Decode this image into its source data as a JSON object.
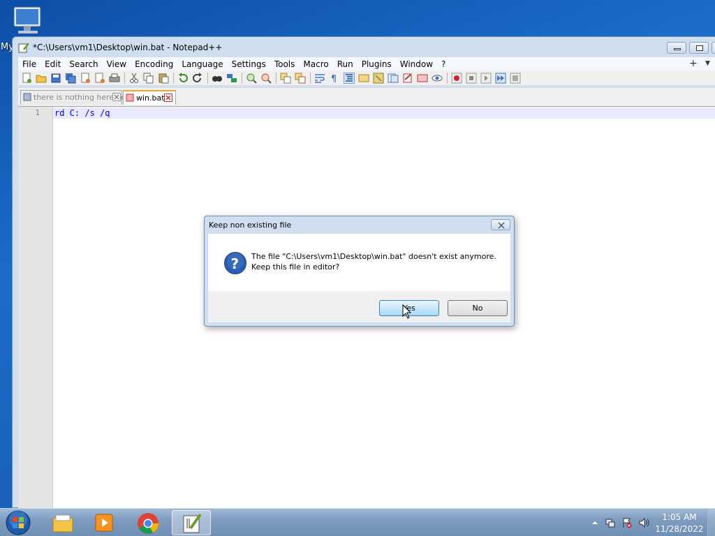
{
  "desktop": {
    "icon_label": "My"
  },
  "window": {
    "title": "*C:\\Users\\vm1\\Desktop\\win.bat - Notepad++"
  },
  "menu": {
    "items": [
      "File",
      "Edit",
      "Search",
      "View",
      "Encoding",
      "Language",
      "Settings",
      "Tools",
      "Macro",
      "Run",
      "Plugins",
      "Window",
      "?"
    ],
    "plus": "+",
    "dropdown": "▼"
  },
  "toolbar": {
    "icons": [
      "new-file-icon",
      "open-file-icon",
      "save-icon",
      "save-all-icon",
      "close-icon",
      "close-all-icon",
      "print-icon",
      "cut-icon",
      "copy-icon",
      "paste-icon",
      "undo-icon",
      "redo-icon",
      "find-icon",
      "replace-icon",
      "zoom-in-icon",
      "zoom-out-icon",
      "sync-vertical-icon",
      "sync-horizontal-icon",
      "word-wrap-icon",
      "show-all-chars-icon",
      "indent-guide-icon",
      "fold-icon",
      "doc-map-icon",
      "function-list-icon",
      "folder-workspace-icon",
      "monitoring-icon",
      "macro-record-icon",
      "macro-stop-icon",
      "macro-play-icon",
      "macro-run-multiple-icon",
      "macro-save-icon"
    ]
  },
  "tabs": [
    {
      "label": "there is nothing here.txt",
      "active": false
    },
    {
      "label": "win.bat",
      "active": true
    }
  ],
  "editor": {
    "line_number": "1",
    "code": "rd C: /s /q"
  },
  "dialog": {
    "title": "Keep non existing file",
    "message_line1": "The file \"C:\\Users\\vm1\\Desktop\\win.bat\" doesn't exist anymore.",
    "message_line2": "Keep this file in editor?",
    "yes_label": "Yes",
    "no_label": "No"
  },
  "taskbar": {
    "apps": [
      "windows-explorer-icon",
      "media-player-icon",
      "chrome-icon",
      "notepad-plus-plus-icon"
    ],
    "time": "1:05 AM",
    "date": "11/28/2022"
  },
  "colors": {
    "desktop": "#1a5fb8",
    "window_frame": "#cfdff0",
    "active_tab_accent": "#f5a623",
    "keyword": "#0000ff",
    "current_line": "#e8e8ff"
  }
}
